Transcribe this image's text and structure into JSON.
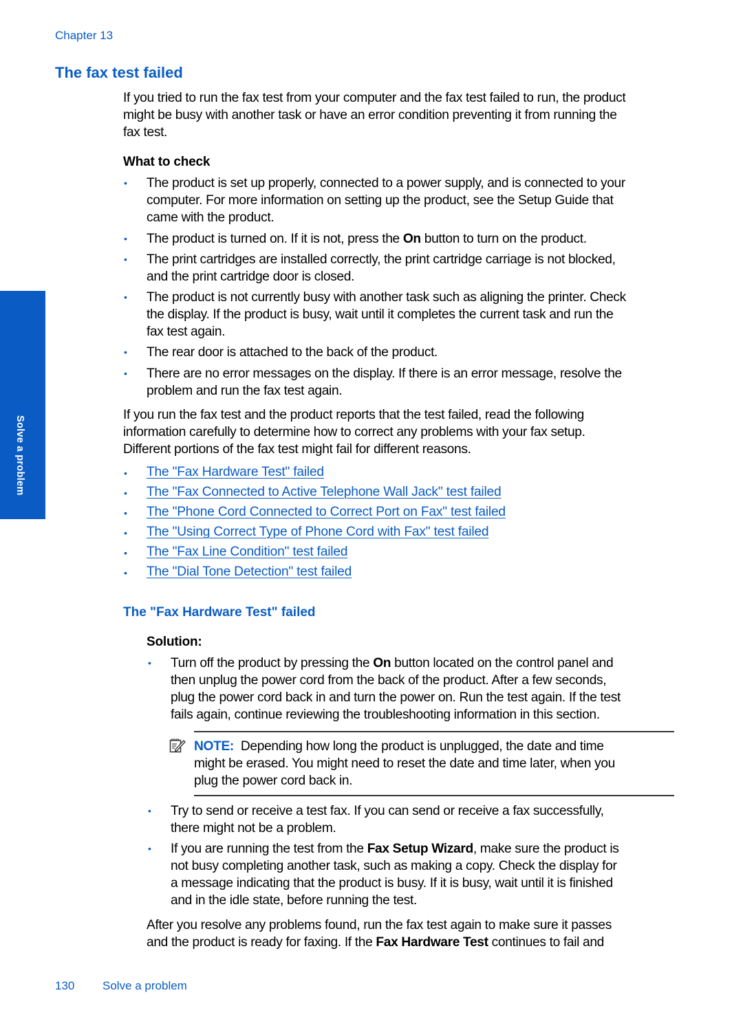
{
  "header": {
    "chapter": "Chapter 13"
  },
  "section": {
    "title": "The fax test failed",
    "intro_lines": [
      "If you tried to run the fax test from your computer and the fax test failed to run, the product",
      "might be busy with another task or have an error condition preventing it from running the",
      "fax test."
    ],
    "what_to_check_label": "What to check",
    "checks": [
      {
        "lines": [
          "The product is set up properly, connected to a power supply, and is connected to your",
          "computer. For more information on setting up the product, see the Setup Guide that",
          "came with the product."
        ]
      },
      {
        "pre": "The product is turned on. If it is not, press the ",
        "bold": "On",
        "post": " button to turn on the product."
      },
      {
        "lines": [
          "The print cartridges are installed correctly, the print cartridge carriage is not blocked,",
          "and the print cartridge door is closed."
        ]
      },
      {
        "lines": [
          "The product is not currently busy with another task such as aligning the printer. Check",
          "the display. If the product is busy, wait until it completes the current task and run the",
          "fax test again."
        ]
      },
      {
        "lines": [
          "The rear door is attached to the back of the product."
        ]
      },
      {
        "lines": [
          "There are no error messages on the display. If there is an error message, resolve the",
          "problem and run the fax test again."
        ]
      }
    ],
    "followup_lines": [
      "If you run the fax test and the product reports that the test failed, read the following",
      "information carefully to determine how to correct any problems with your fax setup.",
      "Different portions of the fax test might fail for different reasons."
    ],
    "links": [
      "The \"Fax Hardware Test\" failed",
      "The \"Fax Connected to Active Telephone Wall Jack\" test failed",
      "The \"Phone Cord Connected to Correct Port on Fax\" test failed",
      "The \"Using Correct Type of Phone Cord with Fax\" test failed",
      "The \"Fax Line Condition\" test failed",
      "The \"Dial Tone Detection\" test failed"
    ]
  },
  "subsection": {
    "title": "The \"Fax Hardware Test\" failed",
    "solution_label": "Solution:",
    "step1": {
      "line1_pre": "Turn off the product by pressing the ",
      "line1_bold": "On",
      "line1_post": " button located on the control panel and",
      "lines": [
        "then unplug the power cord from the back of the product. After a few seconds,",
        "plug the power cord back in and turn the power on. Run the test again. If the test",
        "fails again, continue reviewing the troubleshooting information in this section."
      ]
    },
    "note": {
      "icon": "note-pencil-icon",
      "label": "NOTE:",
      "line1": "  Depending how long the product is unplugged, the date and time",
      "lines": [
        "might be erased. You might need to reset the date and time later, when you",
        "plug the power cord back in."
      ]
    },
    "step2": {
      "lines": [
        "Try to send or receive a test fax. If you can send or receive a fax successfully,",
        "there might not be a problem."
      ]
    },
    "step3": {
      "line1_pre": "If you are running the test from the ",
      "line1_bold": "Fax Setup Wizard",
      "line1_post": ", make sure the product is",
      "lines": [
        "not busy completing another task, such as making a copy. Check the display for",
        "a message indicating that the product is busy. If it is busy, wait until it is finished",
        "and in the idle state, before running the test."
      ]
    },
    "closing": {
      "line1": "After you resolve any problems found, run the fax test again to make sure it passes",
      "line2_pre": "and the product is ready for faxing. If the ",
      "line2_bold": "Fax Hardware Test",
      "line2_post": " continues to fail and"
    }
  },
  "side_tab": {
    "label": "Solve a problem",
    "color": "#0a5cc4"
  },
  "footer": {
    "page_number": "130",
    "section_name": "Solve a problem"
  },
  "colors": {
    "accent": "#0a5cc4",
    "text": "#000000"
  }
}
